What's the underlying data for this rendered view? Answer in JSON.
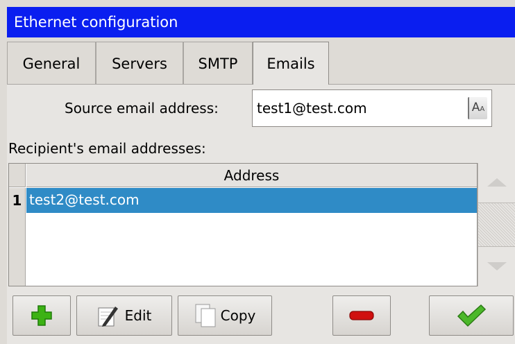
{
  "window": {
    "title": "Ethernet configuration"
  },
  "tabs": [
    {
      "label": "General",
      "active": false
    },
    {
      "label": "Servers",
      "active": false
    },
    {
      "label": "SMTP",
      "active": false
    },
    {
      "label": "Emails",
      "active": true
    }
  ],
  "source": {
    "label": "Source email address:",
    "value": "test1@test.com",
    "keyboard_icon": "keyboard-icon"
  },
  "recipients": {
    "label": "Recipient's email addresses:",
    "column_header": "Address",
    "rows": [
      {
        "num": "1",
        "address": "test2@test.com",
        "selected": true
      }
    ]
  },
  "toolbar": {
    "add_icon": "plus-icon",
    "edit_label": "Edit",
    "edit_icon": "pencil-icon",
    "copy_label": "Copy",
    "copy_icon": "copy-icon",
    "remove_icon": "minus-icon",
    "ok_icon": "checkmark-icon"
  },
  "colors": {
    "titlebar": "#0a1ef0",
    "selection": "#2f8bc6",
    "add": "#3cb214",
    "remove": "#d01010",
    "ok": "#4cb82a"
  }
}
